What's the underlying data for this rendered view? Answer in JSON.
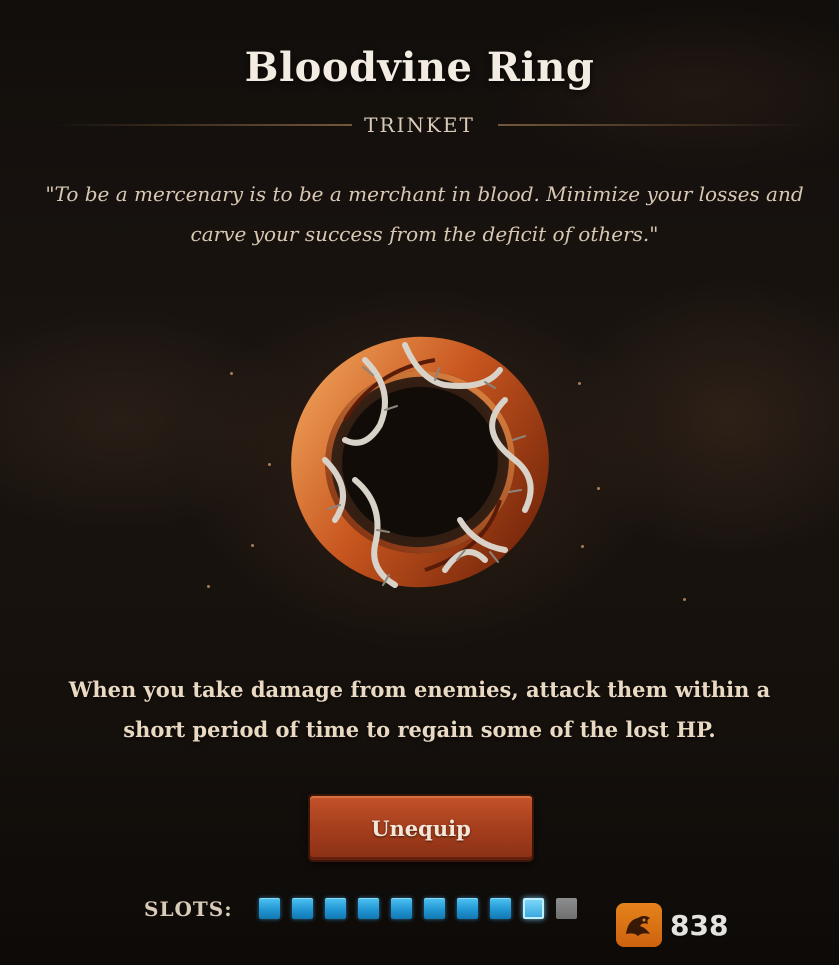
{
  "item": {
    "name": "Bloodvine Ring",
    "category": "TRINKET",
    "quote": "\"To be a mercenary is to be a merchant in blood. Minimize your losses and carve your success from the deficit of others.\"",
    "description": "When you take damage from enemies, attack them within a short period of time to regain some of the lost HP."
  },
  "actions": {
    "unequip_label": "Unequip"
  },
  "slots": {
    "label": "SLOTS:",
    "total": 10,
    "filled": 9,
    "states": [
      "filled",
      "filled",
      "filled",
      "filled",
      "filled",
      "filled",
      "filled",
      "filled",
      "highlight",
      "empty"
    ]
  },
  "watermark": {
    "text": "838"
  },
  "colors": {
    "slot_filled": "#1f93d0",
    "slot_empty": "#7a7a7a",
    "button": "#a8401e",
    "title": "#f3ece2"
  }
}
